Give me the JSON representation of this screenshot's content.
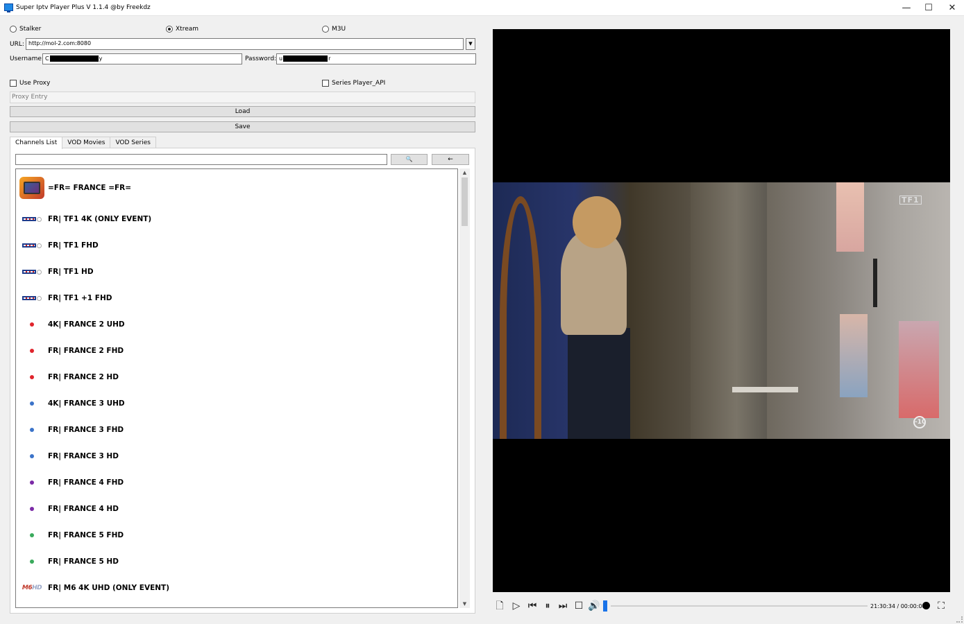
{
  "window": {
    "title": "Super Iptv Player Plus V 1.1.4 @by Freekdz",
    "minimize": "—",
    "maximize": "☐",
    "close": "✕"
  },
  "source": {
    "options": [
      "Stalker",
      "Xtream",
      "M3U"
    ],
    "selected": "Xtream"
  },
  "form": {
    "url_label": "URL:",
    "url_value": "http://mol-2.com:8080",
    "username_label": "Username:",
    "username_prefix": "C",
    "username_suffix": "y",
    "password_label": "Password:",
    "password_prefix": "u",
    "password_suffix": "r",
    "use_proxy_label": "Use Proxy",
    "series_api_label": "Series Player_API",
    "proxy_placeholder": "Proxy Entry",
    "load_label": "Load",
    "save_label": "Save"
  },
  "tabs": [
    "Channels List",
    "VOD Movies",
    "VOD Series"
  ],
  "active_tab": "Channels List",
  "search": {
    "search_icon": "search-icon",
    "search_glyph": "🔍",
    "back_glyph": "←"
  },
  "channels": [
    {
      "name": "=FR= FRANCE =FR=",
      "icon": "tv-category-icon"
    },
    {
      "name": "FR| TF1 4K (ONLY EVENT)",
      "icon": "tf1-logo"
    },
    {
      "name": "FR| TF1 FHD",
      "icon": "tf1-logo"
    },
    {
      "name": "FR| TF1 HD",
      "icon": "tf1-logo"
    },
    {
      "name": "FR| TF1 +1 FHD",
      "icon": "tf1-logo"
    },
    {
      "name": "4K| FRANCE 2 UHD",
      "icon": "dot",
      "color": "#e0242c"
    },
    {
      "name": "FR| FRANCE 2 FHD",
      "icon": "dot",
      "color": "#e0242c"
    },
    {
      "name": "FR| FRANCE 2 HD",
      "icon": "dot",
      "color": "#e0242c"
    },
    {
      "name": "4K| FRANCE 3  UHD",
      "icon": "dot",
      "color": "#3b73c9"
    },
    {
      "name": "FR| FRANCE 3 FHD",
      "icon": "dot",
      "color": "#3b73c9"
    },
    {
      "name": "FR| FRANCE 3 HD",
      "icon": "dot",
      "color": "#3b73c9"
    },
    {
      "name": "FR| FRANCE 4 FHD",
      "icon": "dot",
      "color": "#7b2aa6"
    },
    {
      "name": "FR| FRANCE 4 HD",
      "icon": "dot",
      "color": "#7b2aa6"
    },
    {
      "name": "FR| FRANCE 5 FHD",
      "icon": "dot",
      "color": "#3aaa5c"
    },
    {
      "name": "FR| FRANCE 5 HD",
      "icon": "dot",
      "color": "#3aaa5c"
    },
    {
      "name": "FR| M6 4K UHD (ONLY EVENT)",
      "icon": "m6-logo"
    }
  ],
  "video": {
    "watermark_channel": "TF1",
    "watermark_rating": "-10"
  },
  "player": {
    "time": "21:30:34 / 00:00:00",
    "open_icon": "open-file-icon",
    "play_icon": "play-icon",
    "prev_icon": "previous-icon",
    "pause_icon": "pause-icon",
    "next_icon": "next-icon",
    "stop_icon": "stop-icon",
    "volume_icon": "volume-icon",
    "fullscreen_icon": "fullscreen-icon"
  },
  "colors": {
    "accent": "#1a73e8",
    "window_bg": "#f0f0f0",
    "video_bg": "#000000"
  }
}
